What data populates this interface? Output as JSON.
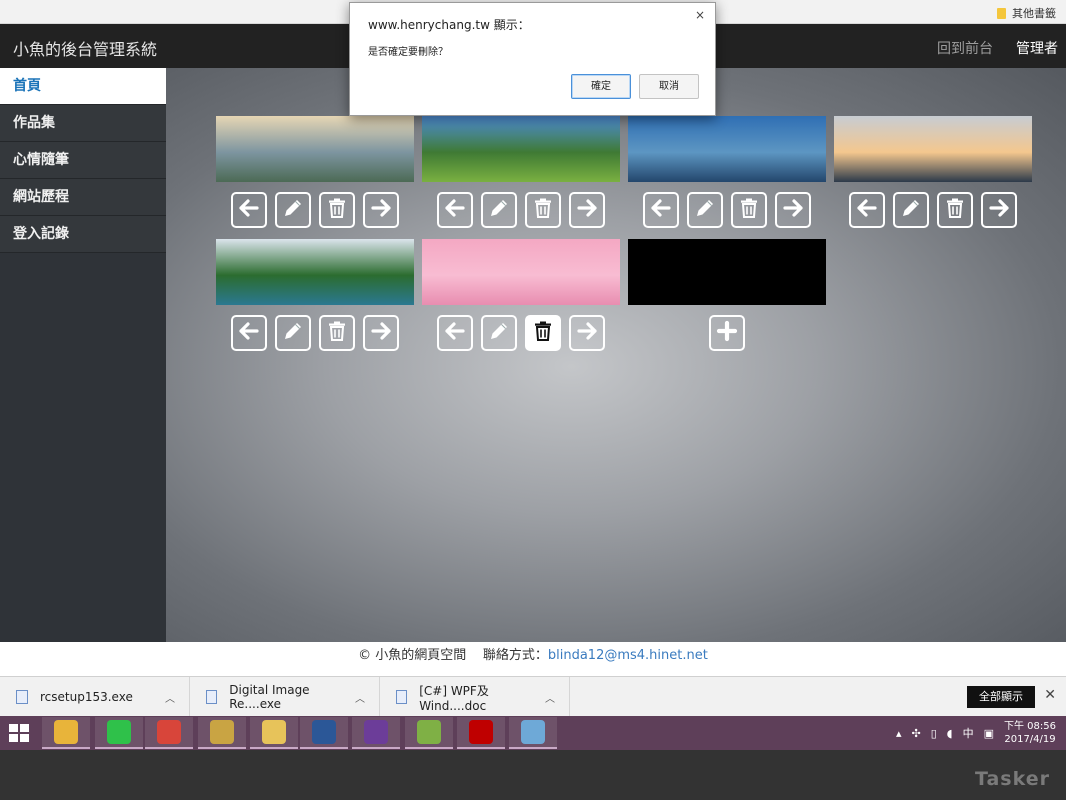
{
  "bookmarks": {
    "other_label": "其他書籤"
  },
  "header": {
    "brand": "小魚的後台管理系統",
    "front_link": "回到前台",
    "admin_link": "管理者"
  },
  "sidebar": {
    "items": [
      {
        "label": "首頁",
        "active": true
      },
      {
        "label": "作品集"
      },
      {
        "label": "心情隨筆"
      },
      {
        "label": "網站歷程"
      },
      {
        "label": "登入記錄"
      }
    ]
  },
  "gallery": {
    "tiles": [
      {
        "name": "lake-valley",
        "colors": [
          "#e6d6b4",
          "#7d95a0",
          "#4c6a55"
        ]
      },
      {
        "name": "green-hills",
        "colors": [
          "#4f8fd8",
          "#3f7a34",
          "#7ab041"
        ]
      },
      {
        "name": "coast-mountain",
        "colors": [
          "#2f6fb4",
          "#5d96c2",
          "#23466c"
        ]
      },
      {
        "name": "bridge-sunset",
        "colors": [
          "#c7ccd2",
          "#f4c78e",
          "#2c3a4a"
        ]
      },
      {
        "name": "alpine-lake",
        "colors": [
          "#dbe4ec",
          "#2b6c2f",
          "#2b7891"
        ]
      },
      {
        "name": "pink-bunny",
        "colors": [
          "#f4a8c3",
          "#f8bcd2",
          "#e88db0"
        ]
      },
      {
        "name": "black-empty",
        "colors": [
          "#000000",
          "#000000",
          "#000000"
        ]
      }
    ],
    "pressed_delete_tile": 5
  },
  "footer": {
    "copyright": "© 小魚的網頁空間",
    "contact_label": "聯絡方式：",
    "email": "blinda12@ms4.hinet.net"
  },
  "downloads": {
    "items": [
      {
        "name": "rcsetup153.exe"
      },
      {
        "name": "Digital Image Re....exe"
      },
      {
        "name": "[C#] WPF及Wind....doc"
      }
    ],
    "show_all": "全部顯示"
  },
  "taskbar": {
    "apps": [
      {
        "name": "outlook-app-icon",
        "color": "#e8b43a"
      },
      {
        "name": "line-app-icon",
        "color": "#2fc14a"
      },
      {
        "name": "chrome-app-icon",
        "color": "#d8453a"
      },
      {
        "name": "tools-app-icon",
        "color": "#c9a443"
      },
      {
        "name": "explorer-app-icon",
        "color": "#e7c35a"
      },
      {
        "name": "word-app-icon",
        "color": "#2b5797"
      },
      {
        "name": "visual-studio-app-icon",
        "color": "#6c3d99"
      },
      {
        "name": "notepad-app-icon",
        "color": "#7fb045"
      },
      {
        "name": "filezilla-app-icon",
        "color": "#bf0000"
      },
      {
        "name": "paint-app-icon",
        "color": "#6ea9d7"
      }
    ],
    "ime": "中",
    "time": "下午 08:56",
    "date": "2017/4/19"
  },
  "watermark": "Tasker",
  "dialog": {
    "title": "www.henrychang.tw 顯示：",
    "message": "是否確定要刪除？",
    "ok": "確定",
    "cancel": "取消",
    "close": "×"
  }
}
